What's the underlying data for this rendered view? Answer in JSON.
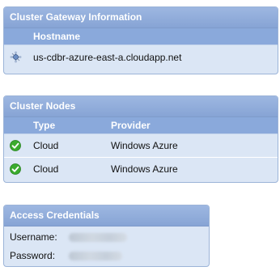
{
  "gateway": {
    "title": "Cluster Gateway Information",
    "column_hostname": "Hostname",
    "hostname": "us-cdbr-azure-east-a.cloudapp.net",
    "icon": "network-node-icon"
  },
  "nodes": {
    "title": "Cluster Nodes",
    "column_type": "Type",
    "column_provider": "Provider",
    "rows": [
      {
        "type": "Cloud",
        "provider": "Windows Azure",
        "status_icon": "green-check-icon"
      },
      {
        "type": "Cloud",
        "provider": "Windows Azure",
        "status_icon": "green-check-icon"
      }
    ]
  },
  "credentials": {
    "title": "Access Credentials",
    "username_label": "Username:",
    "password_label": "Password:"
  },
  "colors": {
    "panel_header": "#8fabdb",
    "panel_body": "#dbe6f5",
    "panel_border": "#9cb4d8",
    "check_green": "#3bab2e"
  }
}
